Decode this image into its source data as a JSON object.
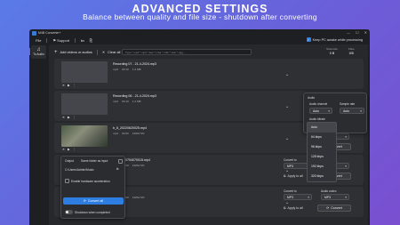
{
  "banner": {
    "title": "ADVANCED SETTINGS",
    "subtitle": "Balance between quality and file size - shutdown after converting"
  },
  "window": {
    "title": "M4B Converter+",
    "controls": [
      "—",
      "☐",
      "✕"
    ]
  },
  "menu": {
    "file": "File",
    "support": "Support",
    "keep_awake_label": "Keep PC awake while processing",
    "keep_awake_checked": true
  },
  "sidebar": {
    "active_label": "To Audio"
  },
  "toolbar": {
    "add_label": "Add videos or audios",
    "clear_label": "Clear all",
    "search_placeholder": "Type *.mp4 *.mp3 *.aac *.m4a *.m4b *.wav *.ogg ...",
    "stats": [
      {
        "label": "Total size",
        "value": "0 B"
      },
      {
        "label": "Files",
        "value": "0/5"
      }
    ]
  },
  "rows": [
    {
      "name": "Recording 07 - 21-4-2024.mp3",
      "meta": [
        "mp3",
        "00:10",
        "1.2 MB"
      ],
      "type": "audio"
    },
    {
      "name": "Recording 06 - 21-4-2024.mp3",
      "meta": [
        "mp3",
        "00:10",
        "1.2 MB"
      ],
      "type": "audio"
    },
    {
      "name": "b_6_20220620025.mp4",
      "meta": [
        "mp4",
        "00:00",
        "1280x720"
      ],
      "type": "video"
    },
    {
      "name": "VID20220704070015.mp4",
      "meta": [
        "mp4",
        "00:00",
        "1280x720"
      ],
      "type": "video"
    },
    {
      "name": "Blender",
      "meta": [
        "mp4",
        "00:00",
        "1280x720"
      ],
      "type": "video"
    }
  ],
  "convert": {
    "convert_to_label": "Convert to",
    "convert_to_value": "MP3",
    "audio_codec_label": "Audio codec",
    "audio_codec_value": "MP3",
    "apply_all": "Apply to all",
    "convert_label": "Convert"
  },
  "audio_popup": {
    "title": "Audio",
    "channel_label": "Audio channel",
    "channel_value": "Auto",
    "sample_rate_label": "Sample rate",
    "sample_rate_value": "Auto",
    "bitrate_label": "Audio bitrate",
    "bitrate_options": [
      "Auto",
      "64 kbps",
      "96 kbps",
      "128 kbps",
      "192 kbps",
      "320 kbps"
    ],
    "bitrate_selected": "Auto"
  },
  "output_popup": {
    "title": "Output",
    "same_folder_label": "Same folder as input",
    "folder_path": "C:\\Users\\Admin\\Music",
    "hw_accel_label": "Enable hardware acceleration",
    "convert_all_label": "Convert all",
    "shutdown_label": "Shutdown when completed"
  },
  "colors": {
    "accent": "#2e7de0",
    "background_gradient_start": "#5a7be8",
    "background_gradient_end": "#7a4fd0",
    "panel": "#27282c"
  }
}
